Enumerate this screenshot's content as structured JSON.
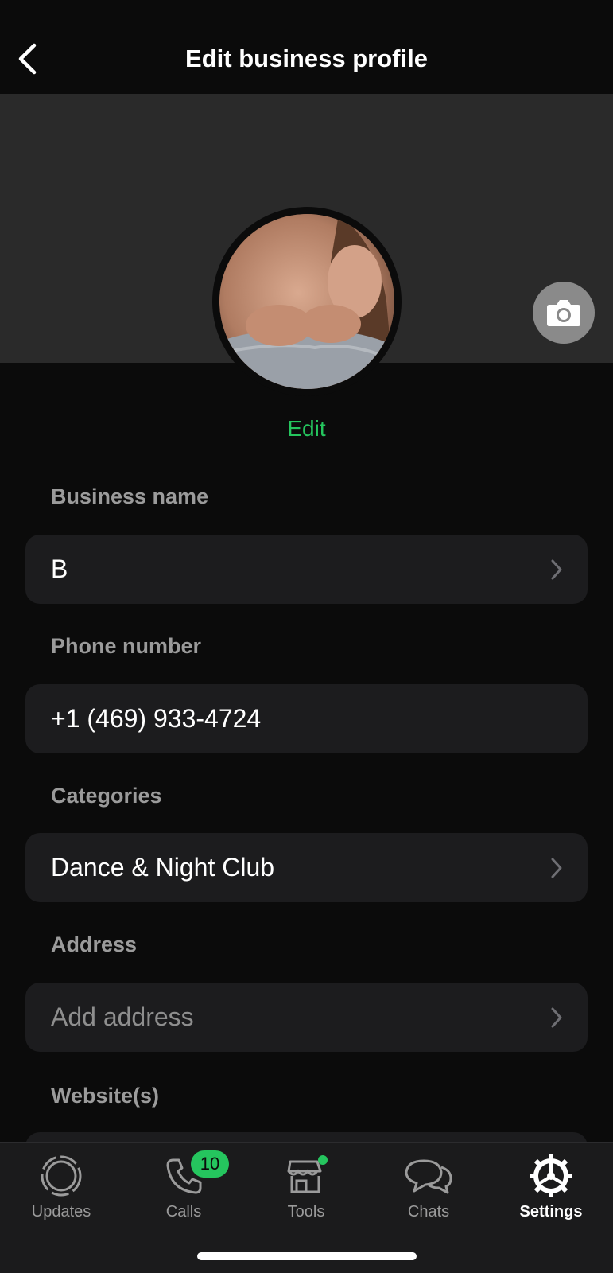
{
  "header": {
    "title": "Edit business profile"
  },
  "profile": {
    "edit_label": "Edit"
  },
  "fields": [
    {
      "label": "Business name",
      "value": "B",
      "placeholder": ""
    },
    {
      "label": "Phone number",
      "value": "+1 (469) 933-4724",
      "placeholder": ""
    },
    {
      "label": "Categories",
      "value": "Dance & Night Club",
      "placeholder": ""
    },
    {
      "label": "Address",
      "value": "",
      "placeholder": "Add address"
    },
    {
      "label": "Website(s)",
      "value": "",
      "placeholder": ""
    }
  ],
  "tabbar": {
    "items": [
      {
        "label": "Updates",
        "icon": "updates-icon"
      },
      {
        "label": "Calls",
        "icon": "phone-icon",
        "badge": "10"
      },
      {
        "label": "Tools",
        "icon": "storefront-icon"
      },
      {
        "label": "Chats",
        "icon": "chat-bubbles-icon"
      },
      {
        "label": "Settings",
        "icon": "gear-icon",
        "active": true
      }
    ]
  },
  "colors": {
    "accent": "#25c55e",
    "background": "#0b0b0b",
    "field": "#1c1c1e",
    "cover": "#2a2a2a"
  }
}
